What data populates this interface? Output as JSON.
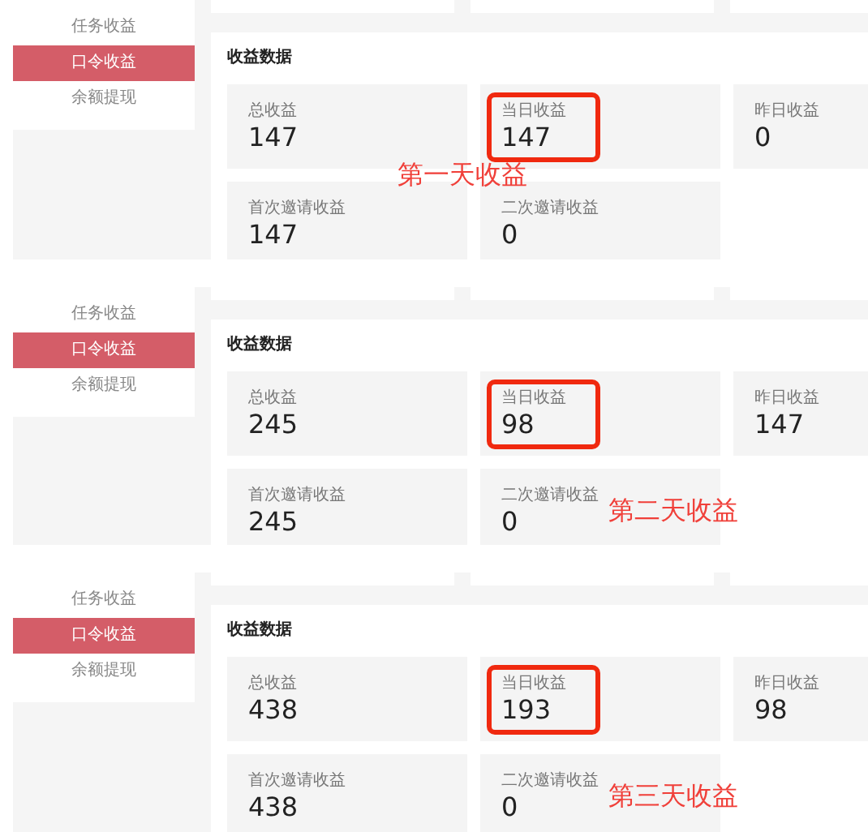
{
  "panels": [
    {
      "sidebar": {
        "items": [
          {
            "label": "任务收益",
            "selected": false
          },
          {
            "label": "口令收益",
            "selected": true
          },
          {
            "label": "余额提现",
            "selected": false
          }
        ]
      },
      "section_title": "收益数据",
      "stats": [
        {
          "label": "总收益",
          "value": "147",
          "highlighted": false
        },
        {
          "label": "当日收益",
          "value": "147",
          "highlighted": true
        },
        {
          "label": "昨日收益",
          "value": "0",
          "highlighted": false
        },
        {
          "label": "首次邀请收益",
          "value": "147",
          "highlighted": false
        },
        {
          "label": "二次邀请收益",
          "value": "0",
          "highlighted": false
        }
      ],
      "annotation": "第一天收益"
    },
    {
      "sidebar": {
        "items": [
          {
            "label": "任务收益",
            "selected": false
          },
          {
            "label": "口令收益",
            "selected": true
          },
          {
            "label": "余额提现",
            "selected": false
          }
        ]
      },
      "section_title": "收益数据",
      "stats": [
        {
          "label": "总收益",
          "value": "245",
          "highlighted": false
        },
        {
          "label": "当日收益",
          "value": "98",
          "highlighted": true
        },
        {
          "label": "昨日收益",
          "value": "147",
          "highlighted": false
        },
        {
          "label": "首次邀请收益",
          "value": "245",
          "highlighted": false
        },
        {
          "label": "二次邀请收益",
          "value": "0",
          "highlighted": false
        }
      ],
      "annotation": "第二天收益"
    },
    {
      "sidebar": {
        "items": [
          {
            "label": "任务收益",
            "selected": false
          },
          {
            "label": "口令收益",
            "selected": true
          },
          {
            "label": "余额提现",
            "selected": false
          }
        ]
      },
      "section_title": "收益数据",
      "stats": [
        {
          "label": "总收益",
          "value": "438",
          "highlighted": false
        },
        {
          "label": "当日收益",
          "value": "193",
          "highlighted": true
        },
        {
          "label": "昨日收益",
          "value": "98",
          "highlighted": false
        },
        {
          "label": "首次邀请收益",
          "value": "438",
          "highlighted": false
        },
        {
          "label": "二次邀请收益",
          "value": "0",
          "highlighted": false
        }
      ],
      "annotation": "第三天收益"
    }
  ]
}
